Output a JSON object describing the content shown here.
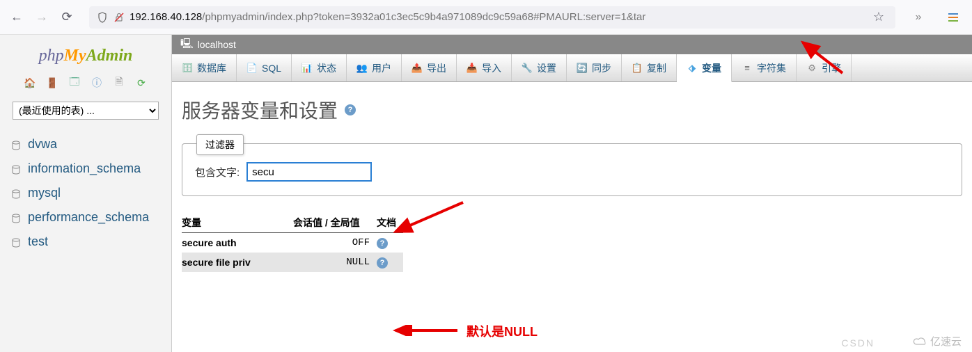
{
  "browser": {
    "url_host": "192.168.40.128",
    "url_path": "/phpmyadmin/index.php?token=3932a01c3ec5c9b4a971089dc9c59a68#PMAURL:server=1&tar"
  },
  "logo": {
    "p1": "php",
    "p2": "My",
    "p3": "Admin"
  },
  "recent_select": "(最近使用的表) ...",
  "databases": [
    {
      "name": "dvwa"
    },
    {
      "name": "information_schema"
    },
    {
      "name": "mysql"
    },
    {
      "name": "performance_schema"
    },
    {
      "name": "test"
    }
  ],
  "breadcrumb": {
    "host": "localhost"
  },
  "tabs": [
    {
      "label": "数据库",
      "icon": "🗄",
      "color": "#5a8"
    },
    {
      "label": "SQL",
      "icon": "📄",
      "color": "#69c"
    },
    {
      "label": "状态",
      "icon": "📊",
      "color": "#c77"
    },
    {
      "label": "用户",
      "icon": "👥",
      "color": "#69c"
    },
    {
      "label": "导出",
      "icon": "📤",
      "color": "#6a6"
    },
    {
      "label": "导入",
      "icon": "📥",
      "color": "#6a6"
    },
    {
      "label": "设置",
      "icon": "🔧",
      "color": "#888"
    },
    {
      "label": "同步",
      "icon": "🔄",
      "color": "#c96"
    },
    {
      "label": "复制",
      "icon": "📋",
      "color": "#888"
    },
    {
      "label": "变量",
      "icon": "⬗",
      "color": "#4aa3df",
      "active": true
    },
    {
      "label": "字符集",
      "icon": "≡",
      "color": "#666"
    },
    {
      "label": "引擎",
      "icon": "⚙",
      "color": "#888"
    }
  ],
  "page_title": "服务器变量和设置",
  "filter": {
    "legend": "过滤器",
    "label": "包含文字:",
    "value": "secu"
  },
  "table": {
    "headers": {
      "var": "变量",
      "val": "会话值 / 全局值",
      "doc": "文档"
    },
    "rows": [
      {
        "name": "secure auth",
        "value": "OFF"
      },
      {
        "name": "secure file priv",
        "value": "NULL",
        "alt": true
      }
    ]
  },
  "annotation": "默认是NULL",
  "watermarks": {
    "w1": "CSDN",
    "w2": "亿速云"
  }
}
